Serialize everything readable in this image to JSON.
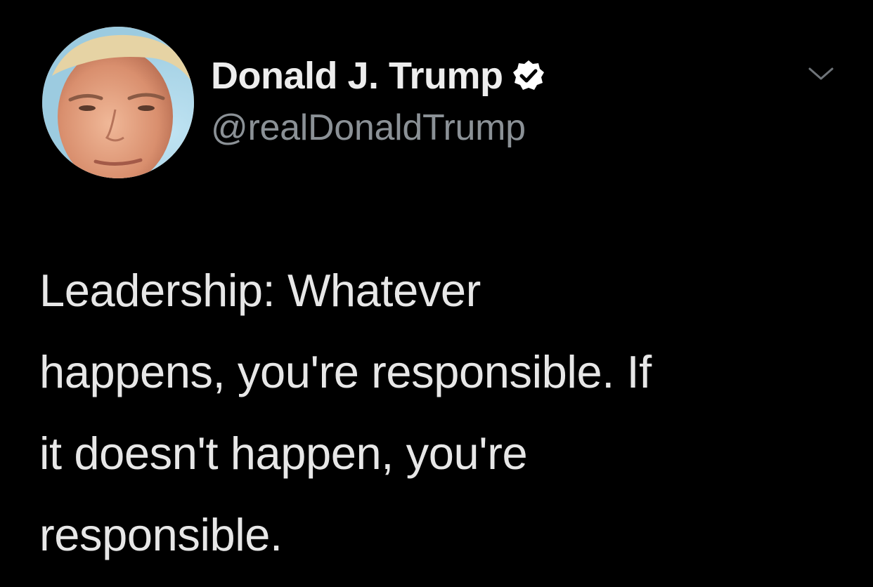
{
  "tweet": {
    "author": {
      "display_name": "Donald J. Trump",
      "handle": "@realDonaldTrump",
      "verified": true,
      "avatar_icon": "profile-photo"
    },
    "menu_icon": "chevron-down-icon",
    "text_lines": [
      "Leadership: Whatever",
      "happens, you're responsible. If",
      "it doesn't happen, you're",
      "responsible."
    ]
  },
  "colors": {
    "background": "#000000",
    "name": "#ededed",
    "handle": "#8b9196",
    "text": "#e7e7e7",
    "verified_badge": "#ffffff"
  }
}
